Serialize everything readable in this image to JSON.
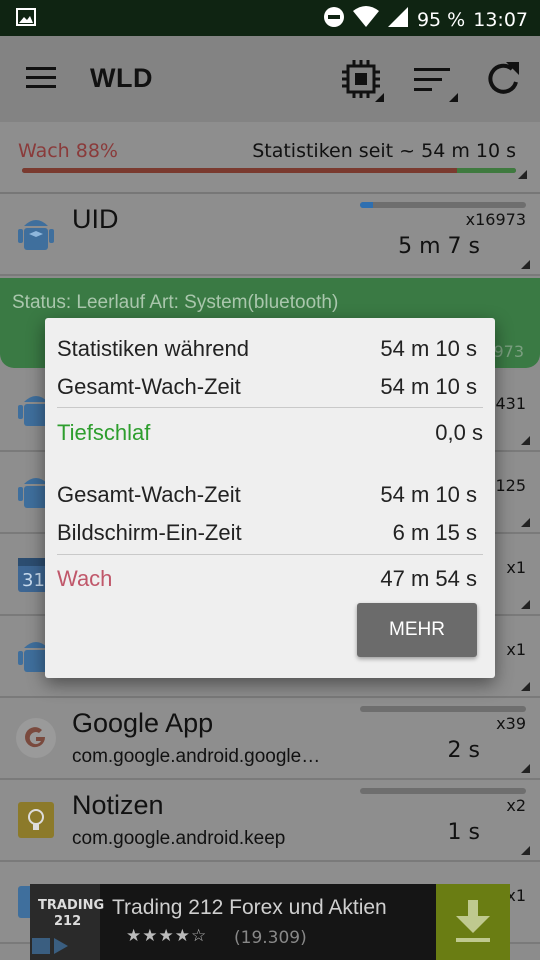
{
  "statusbar": {
    "battery": "95 %",
    "time": "13:07",
    "icons": [
      "image-icon",
      "dnd-icon",
      "wifi-icon",
      "signal-icon"
    ]
  },
  "appbar": {
    "title": "WLD",
    "icons": [
      "menu-icon",
      "cpu-icon",
      "sort-icon",
      "refresh-icon"
    ]
  },
  "summary": {
    "awake": "Wach 88%",
    "since": "Statistiken seit ~ 54 m 10 s",
    "awake_fraction": 0.88,
    "colors": {
      "awake": "#c04a4a",
      "sleep": "#2f9e2f"
    }
  },
  "rows": [
    {
      "name": "UID",
      "package": "",
      "count": "x16973",
      "time": "5 m 7 s",
      "icon": "android-icon",
      "bar_fraction": 0.08
    },
    {
      "name": "",
      "package": "",
      "count": "",
      "time": "",
      "icon": "android-icon"
    },
    {
      "name": "",
      "package": "",
      "count": "",
      "time": "",
      "icon": "android-icon"
    },
    {
      "name": "",
      "package": "",
      "count": "",
      "time": "",
      "icon": "calendar-icon"
    },
    {
      "name": "",
      "package": "",
      "count": "",
      "time": "",
      "icon": "android-icon"
    },
    {
      "name": "Google App",
      "package": "com.google.android.google…",
      "count": "x39",
      "time": "2 s",
      "icon": "google-icon"
    },
    {
      "name": "Notizen",
      "package": "com.google.android.keep",
      "count": "x2",
      "time": "1 s",
      "icon": "keep-icon"
    }
  ],
  "peeking": {
    "row2_count": "973",
    "row3_count": "431",
    "row4_count": "125",
    "row5_count": "x1",
    "row6_count": "x1",
    "row7_count": "x1"
  },
  "status_row": {
    "text": "Status: Leerlauf  Art: System(bluetooth)"
  },
  "dialog": {
    "stats_during_label": "Statistiken während",
    "stats_during_value": "54 m 10 s",
    "total_awake_label": "Gesamt-Wach-Zeit",
    "total_awake_value": "54 m 10 s",
    "deep_sleep_label": "Tiefschlaf",
    "deep_sleep_value": "0,0 s",
    "total_awake_label_2": "Gesamt-Wach-Zeit",
    "total_awake_value_2": "54 m 10 s",
    "screen_on_label": "Bildschirm-Ein-Zeit",
    "screen_on_value": "6 m 15 s",
    "awake_label": "Wach",
    "awake_value": "47 m 54 s",
    "more_button": "MEHR",
    "colors": {
      "deep_sleep": "#2e9e2e",
      "awake": "#c0576a"
    }
  },
  "ad": {
    "logo_line1": "TRADING",
    "logo_line2": "212",
    "title": "Trading 212 Forex und Aktien",
    "stars": "★★★★☆",
    "reviews": "(19.309)",
    "icon": "download-icon"
  }
}
